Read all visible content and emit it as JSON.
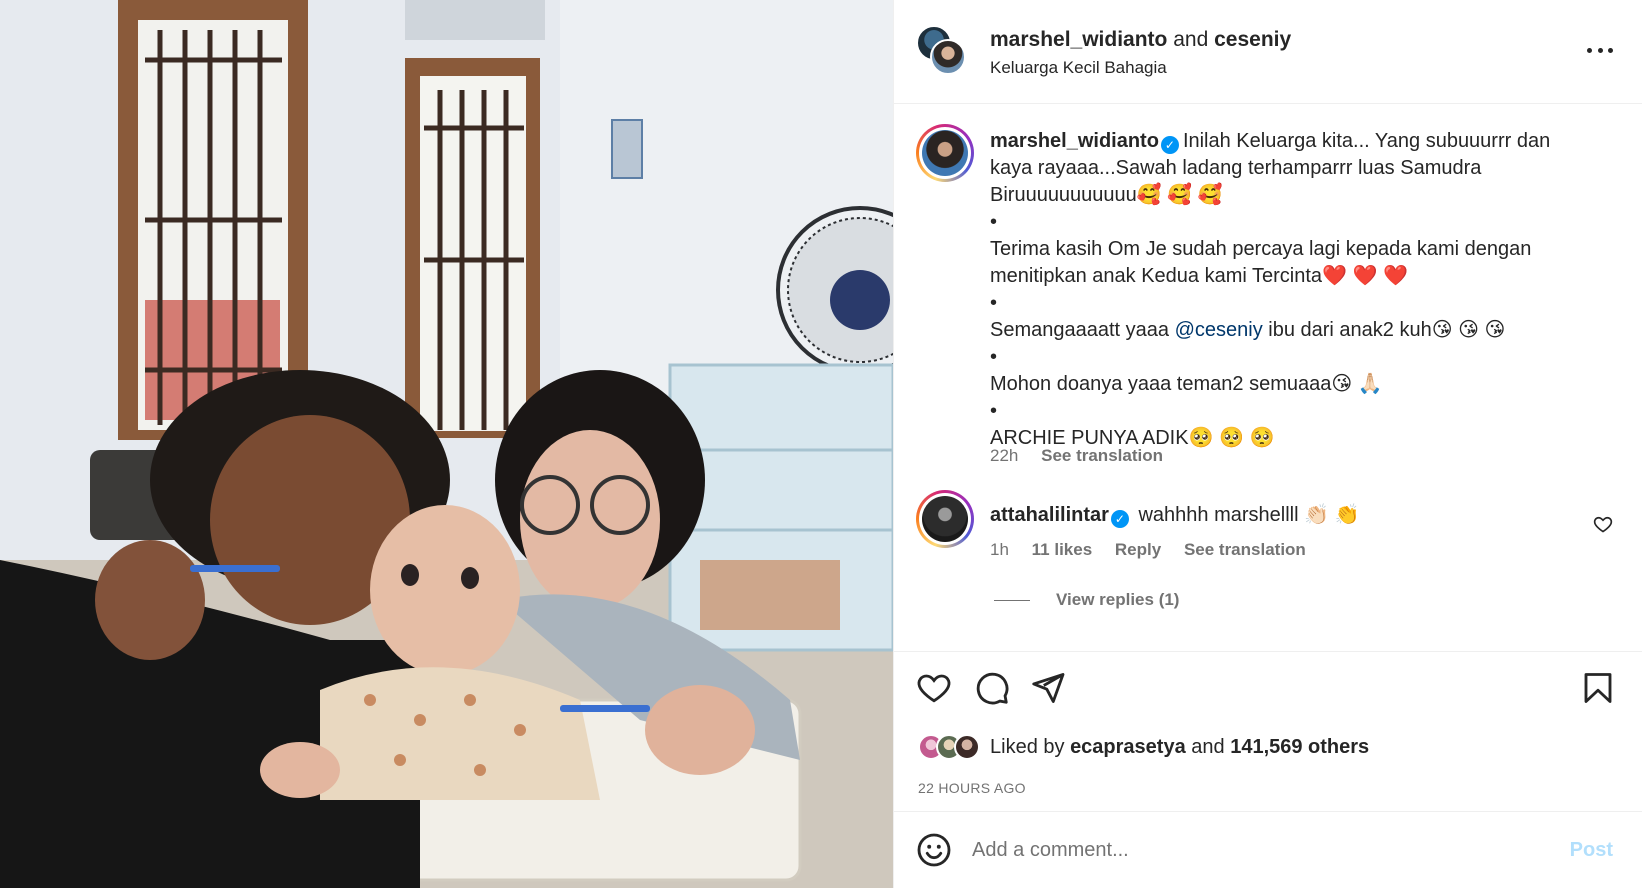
{
  "header": {
    "user1": "marshel_widianto",
    "and_text": "and",
    "user2": "ceseniy",
    "subtitle": "Keluarga Kecil Bahagia",
    "more_icon": "more-horizontal-icon"
  },
  "caption": {
    "username": "marshel_widianto",
    "verified_mark": "✓",
    "lines": [
      "Inilah Keluarga kita... Yang subuuurrr dan",
      "kaya rayaaa...Sawah ladang terhamparrr luas Samudra",
      "Biruuuuuuuuuuu🥰 🥰 🥰",
      "•",
      "Terima kasih Om Je sudah percaya lagi kepada kami dengan",
      "menitipkan anak Kedua kami Tercinta❤️ ❤️ ❤️",
      "•"
    ],
    "line8_prefix": "Semangaaaatt yaaa ",
    "line8_mention": "@ceseniy",
    "line8_suffix": " ibu dari anak2 kuh😘 😘 😘",
    "lines_after": [
      "•",
      "Mohon doanya yaaa teman2 semuaaa😘 🙏🏻",
      "•",
      "ARCHIE PUNYA ADIK🥺 🥺 🥺"
    ],
    "time": "22h",
    "see_translation": "See translation"
  },
  "comment": {
    "username": "attahalilintar",
    "verified_mark": "✓",
    "text": "wahhhh marshellll 👏🏻 👏",
    "time": "1h",
    "likes": "11 likes",
    "reply": "Reply",
    "see_translation": "See translation",
    "view_replies": "View replies (1)"
  },
  "actions": {
    "like_icon": "heart-icon",
    "comment_icon": "comment-icon",
    "share_icon": "send-icon",
    "save_icon": "bookmark-icon"
  },
  "likes": {
    "prefix": "Liked by ",
    "user": "ecaprasetya",
    "middle": " and ",
    "count": "141,569 others",
    "ago": "22 HOURS AGO"
  },
  "add_comment": {
    "placeholder": "Add a comment...",
    "post_label": "Post",
    "emoji_icon": "smiley-icon"
  },
  "colors": {
    "link_blue": "#00376b",
    "verified_blue": "#0095f6",
    "post_disabled": "#b2dffc",
    "muted": "#737373"
  }
}
